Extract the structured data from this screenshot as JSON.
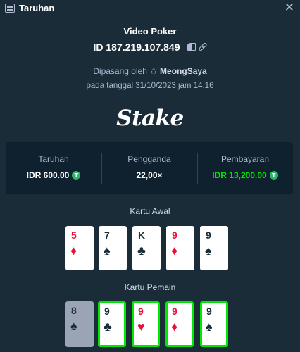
{
  "header": {
    "title": "Taruhan",
    "close": "✕",
    "icon": "bet-slip-icon"
  },
  "bet": {
    "game": "Video Poker",
    "id": "ID 187.219.107.849",
    "placed_by_prefix": "Dipasang oleh",
    "username": "MeongSaya",
    "date": "pada tanggal 31/10/2023 jam 14.16"
  },
  "logo": "Stake",
  "summary": {
    "bet_label": "Taruhan",
    "bet_value": "IDR 600.00",
    "multiplier_label": "Pengganda",
    "multiplier_value": "22,00×",
    "payout_label": "Pembayaran",
    "payout_value": "IDR 13,200.00",
    "coin_symbol": "T"
  },
  "initial_hand": {
    "title": "Kartu Awal",
    "cards": [
      {
        "rank": "5",
        "suit": "♦",
        "color": "red"
      },
      {
        "rank": "7",
        "suit": "♠",
        "color": "black"
      },
      {
        "rank": "K",
        "suit": "♣",
        "color": "black"
      },
      {
        "rank": "9",
        "suit": "♦",
        "color": "red"
      },
      {
        "rank": "9",
        "suit": "♠",
        "color": "black"
      }
    ]
  },
  "player_hand": {
    "title": "Kartu Pemain",
    "cards": [
      {
        "rank": "8",
        "suit": "♠",
        "color": "black",
        "held": false
      },
      {
        "rank": "9",
        "suit": "♣",
        "color": "black",
        "held": true
      },
      {
        "rank": "9",
        "suit": "♥",
        "color": "red",
        "held": true
      },
      {
        "rank": "9",
        "suit": "♦",
        "color": "red",
        "held": true
      },
      {
        "rank": "9",
        "suit": "♠",
        "color": "black",
        "held": true
      }
    ]
  },
  "colors": {
    "background": "#1a2c38",
    "panel": "#0f212e",
    "win_green": "#00e701",
    "red_suit": "#e9113c"
  }
}
